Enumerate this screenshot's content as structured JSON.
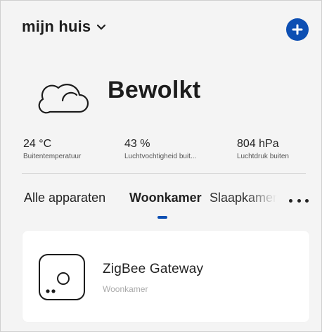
{
  "header": {
    "home_name": "mijn huis",
    "dropdown_icon": "chevron-down-icon",
    "add_icon": "plus-circle-icon"
  },
  "weather": {
    "icon": "cloud-icon",
    "condition": "Bewolkt",
    "stats": [
      {
        "value": "24 °C",
        "label": "Buitentemperatuur"
      },
      {
        "value": "43 %",
        "label": "Luchtvochtigheid buit..."
      },
      {
        "value": "804 hPa",
        "label": "Luchtdruk buiten"
      }
    ]
  },
  "tabs": {
    "items": [
      "Alle apparaten",
      "Woonkamer",
      "Slaapkamer"
    ],
    "active": "Woonkamer",
    "more_icon": "more-horizontal-icon"
  },
  "devices": [
    {
      "name": "ZigBee Gateway",
      "room": "Woonkamer",
      "icon": "gateway-icon"
    }
  ],
  "colors": {
    "accent": "#0d4fb3",
    "background": "#f4f4f4",
    "card": "#ffffff"
  }
}
